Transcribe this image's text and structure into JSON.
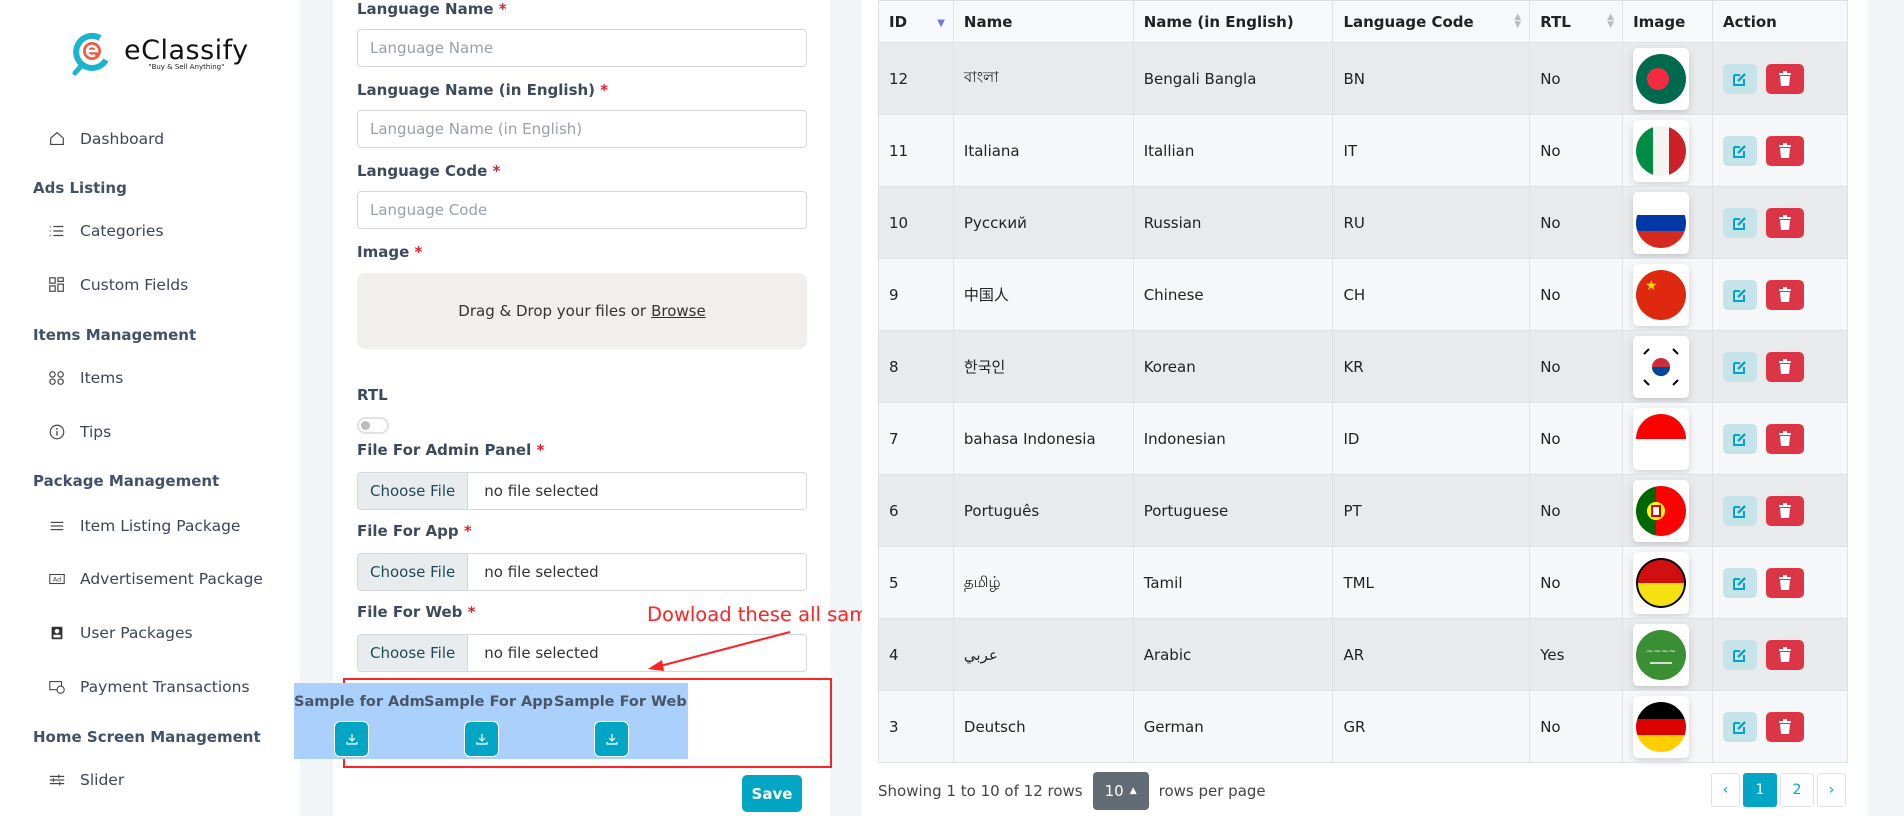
{
  "brand": {
    "name": "eClassify",
    "tagline": "\"Buy & Sell Anything\""
  },
  "sidebar": {
    "items": [
      {
        "type": "item",
        "label": "Dashboard",
        "icon": "home-icon"
      },
      {
        "type": "head",
        "label": "Ads Listing"
      },
      {
        "type": "item",
        "label": "Categories",
        "icon": "list-icon"
      },
      {
        "type": "item",
        "label": "Custom Fields",
        "icon": "grid-icon"
      },
      {
        "type": "head",
        "label": "Items Management"
      },
      {
        "type": "item",
        "label": "Items",
        "icon": "circles-icon"
      },
      {
        "type": "item",
        "label": "Tips",
        "icon": "info-icon"
      },
      {
        "type": "head",
        "label": "Package Management"
      },
      {
        "type": "item",
        "label": "Item Listing Package",
        "icon": "menu-icon"
      },
      {
        "type": "item",
        "label": "Advertisement Package",
        "icon": "ad-icon"
      },
      {
        "type": "item",
        "label": "User Packages",
        "icon": "user-badge-icon"
      },
      {
        "type": "item",
        "label": "Payment Transactions",
        "icon": "payment-icon"
      },
      {
        "type": "head",
        "label": "Home Screen Management"
      },
      {
        "type": "item",
        "label": "Slider",
        "icon": "sliders-icon"
      }
    ]
  },
  "form": {
    "language_name": {
      "label": "Language Name",
      "placeholder": "Language Name"
    },
    "language_name_en": {
      "label": "Language Name (in English)",
      "placeholder": "Language Name (in English)"
    },
    "language_code": {
      "label": "Language Code",
      "placeholder": "Language Code"
    },
    "image": {
      "label": "Image",
      "drop_text": "Drag & Drop your files or",
      "browse": "Browse"
    },
    "rtl": {
      "label": "RTL",
      "checked": false
    },
    "file_admin": {
      "label": "File For Admin Panel",
      "button": "Choose File",
      "value": "no file selected"
    },
    "file_app": {
      "label": "File For App",
      "button": "Choose File",
      "value": "no file selected"
    },
    "file_web": {
      "label": "File For Web",
      "button": "Choose File",
      "value": "no file selected"
    },
    "required_mark": "*",
    "samples": [
      "Sample for Admin",
      "Sample For App",
      "Sample For Web"
    ],
    "save": "Save"
  },
  "annotation": "Dowload these all sample English JSON files",
  "table": {
    "headers": [
      "ID",
      "Name",
      "Name (in English)",
      "Language Code",
      "RTL",
      "Image",
      "Action"
    ],
    "rows": [
      {
        "id": "12",
        "name": "বাংলা",
        "name_en": "Bengali Bangla",
        "code": "BN",
        "rtl": "No",
        "flag": "bangladesh"
      },
      {
        "id": "11",
        "name": "Italiana",
        "name_en": "Itallian",
        "code": "IT",
        "rtl": "No",
        "flag": "italy"
      },
      {
        "id": "10",
        "name": "Русский",
        "name_en": "Russian",
        "code": "RU",
        "rtl": "No",
        "flag": "russia"
      },
      {
        "id": "9",
        "name": "中国人",
        "name_en": "Chinese",
        "code": "CH",
        "rtl": "No",
        "flag": "china"
      },
      {
        "id": "8",
        "name": "한국인",
        "name_en": "Korean",
        "code": "KR",
        "rtl": "No",
        "flag": "korea"
      },
      {
        "id": "7",
        "name": "bahasa Indonesia",
        "name_en": "Indonesian",
        "code": "ID",
        "rtl": "No",
        "flag": "indonesia"
      },
      {
        "id": "6",
        "name": "Português",
        "name_en": "Portuguese",
        "code": "PT",
        "rtl": "No",
        "flag": "portugal"
      },
      {
        "id": "5",
        "name": "தமிழ்",
        "name_en": "Tamil",
        "code": "TML",
        "rtl": "No",
        "flag": "tamil"
      },
      {
        "id": "4",
        "name": "عربي",
        "name_en": "Arabic",
        "code": "AR",
        "rtl": "Yes",
        "flag": "saudi"
      },
      {
        "id": "3",
        "name": "Deutsch",
        "name_en": "German",
        "code": "GR",
        "rtl": "No",
        "flag": "germany"
      }
    ],
    "footer": {
      "showing": "Showing 1 to 10 of 12 rows",
      "per_page": "10",
      "per_page_suffix": "rows per page"
    },
    "pagination": {
      "prev": "‹",
      "pages": [
        "1",
        "2"
      ],
      "active": "1",
      "next": "›"
    }
  },
  "colors": {
    "accent": "#00a6c4",
    "danger": "#dc3545",
    "annotation": "#ff2222"
  }
}
